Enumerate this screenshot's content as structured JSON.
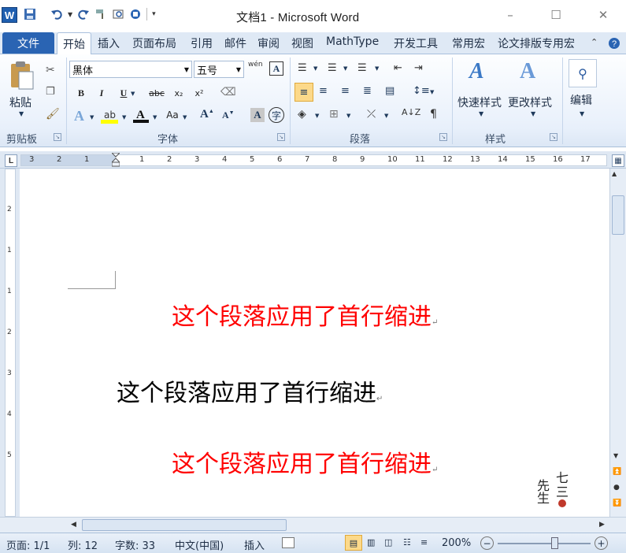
{
  "window": {
    "title": "文档1 - Microsoft Word",
    "app_icon": "W",
    "min_label": "–",
    "max_label": "☐",
    "close_label": "✕"
  },
  "quick_access": {
    "save_icon": "save-icon",
    "undo_icon": "undo-icon",
    "redo_icon": "redo-icon"
  },
  "tabs": {
    "file": "文件",
    "home": "开始",
    "items": [
      "插入",
      "页面布局",
      "引用",
      "邮件",
      "审阅",
      "视图",
      "MathType",
      "开发工具",
      "常用宏",
      "论文排版专用宏"
    ]
  },
  "ribbon": {
    "clipboard": {
      "label": "剪贴板",
      "paste": "粘贴"
    },
    "font": {
      "label": "字体",
      "font_name": "黑体",
      "font_size": "五号",
      "wen": "wén",
      "bold": "B",
      "italic": "I",
      "underline": "U",
      "strike": "abc",
      "sub": "x₂",
      "sup": "x²",
      "aa": "Aa"
    },
    "paragraph": {
      "label": "段落"
    },
    "styles": {
      "label": "样式",
      "quick": "快速样式",
      "change": "更改样式"
    },
    "editing": {
      "label": "编辑",
      "edit": "编辑"
    }
  },
  "ruler": {
    "left_ticks": [
      "3",
      "2",
      "1"
    ],
    "ticks": [
      "1",
      "2",
      "3",
      "4",
      "5",
      "6",
      "7",
      "8",
      "9",
      "10",
      "11",
      "12",
      "13",
      "14",
      "15",
      "16",
      "17"
    ],
    "v_ticks": [
      "2",
      "1",
      "1",
      "2",
      "3",
      "4",
      "5"
    ]
  },
  "document": {
    "lines": [
      {
        "text": "这个段落应用了首行缩进",
        "color": "#ff0000"
      },
      {
        "text": "这个段落应用了首行缩进",
        "color": "#000000"
      },
      {
        "text": "这个段落应用了首行缩进",
        "color": "#ff0000"
      }
    ],
    "return_mark": "↵",
    "seal_text": "七三先生"
  },
  "status": {
    "page": "页面: 1/1",
    "column": "列: 12",
    "wordcount": "字数: 33",
    "language": "中文(中国)",
    "insert": "插入",
    "zoom": "200%"
  }
}
